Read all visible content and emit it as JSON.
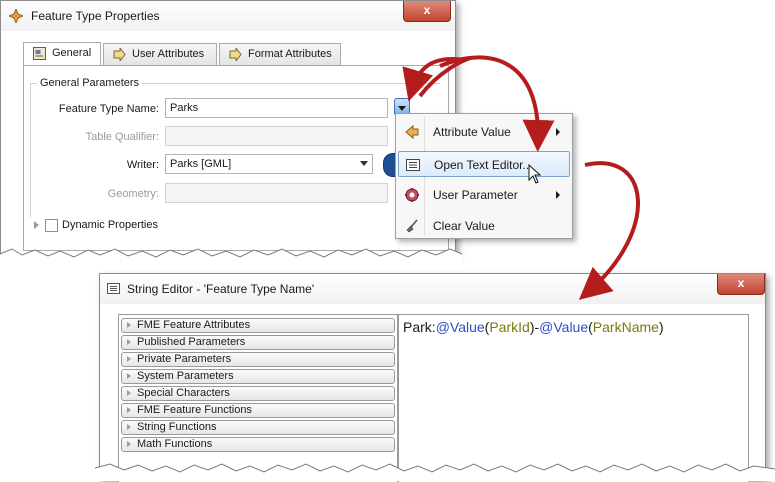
{
  "feature_type_properties": {
    "title": "Feature Type Properties",
    "close": "x",
    "tabs": [
      {
        "label": "General",
        "active": true
      },
      {
        "label": "User Attributes",
        "active": false
      },
      {
        "label": "Format Attributes",
        "active": false
      }
    ],
    "group_title": "General Parameters",
    "fields": {
      "feature_type_name": {
        "label": "Feature Type Name:",
        "value": "Parks"
      },
      "table_qualifier": {
        "label": "Table Qualifier:",
        "value": ""
      },
      "writer": {
        "label": "Writer:",
        "value": "Parks [GML]"
      },
      "geometry": {
        "label": "Geometry:",
        "value": ""
      }
    },
    "dynamic_properties": "Dynamic Properties"
  },
  "context_menu": {
    "items": [
      {
        "label": "Attribute Value",
        "icon": "attribute-value-icon",
        "submenu": true
      },
      {
        "label": "Open Text Editor...",
        "icon": "text-editor-icon",
        "submenu": false,
        "highlighted": true
      },
      {
        "label": "User Parameter",
        "icon": "user-parameter-icon",
        "submenu": true
      },
      {
        "label": "Clear Value",
        "icon": "broom-icon",
        "submenu": false
      }
    ]
  },
  "string_editor": {
    "title": "String Editor - 'Feature Type Name'",
    "close": "x",
    "categories": [
      "FME Feature Attributes",
      "Published Parameters",
      "Private Parameters",
      "System Parameters",
      "Special Characters",
      "FME Feature Functions",
      "String Functions",
      "Math Functions"
    ],
    "expression_tokens": [
      {
        "text": "Park:",
        "kind": "plain"
      },
      {
        "text": "@Value",
        "kind": "func"
      },
      {
        "text": "(",
        "kind": "plain"
      },
      {
        "text": "ParkId",
        "kind": "arg"
      },
      {
        "text": ")-",
        "kind": "plain"
      },
      {
        "text": "@Value",
        "kind": "func"
      },
      {
        "text": "(",
        "kind": "plain"
      },
      {
        "text": "ParkName",
        "kind": "arg"
      },
      {
        "text": ")",
        "kind": "plain"
      }
    ]
  },
  "colors": {
    "arrow": "#b51c1c",
    "highlight_border": "#7da2ce",
    "function_token": "#2b4fc0",
    "argument_token": "#7a7a0c"
  }
}
